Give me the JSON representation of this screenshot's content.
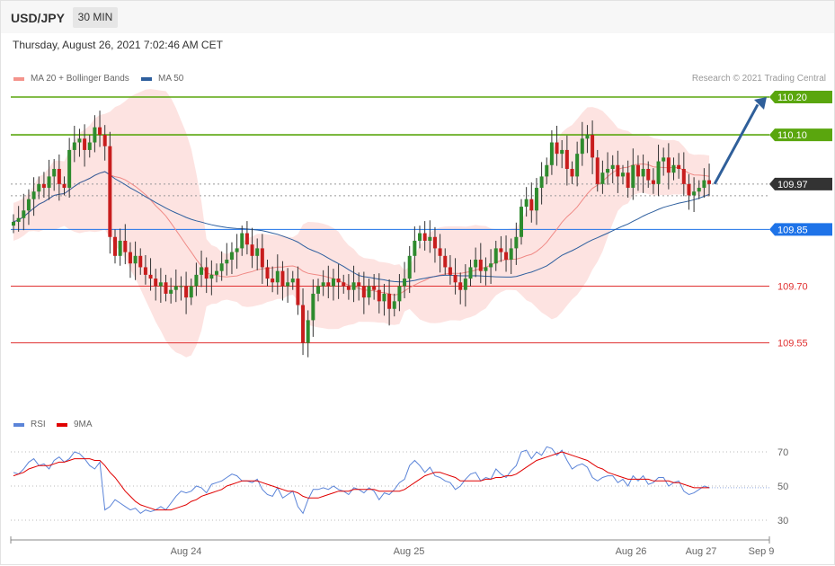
{
  "header": {
    "symbol": "USD/JPY",
    "timeframe": "30 MIN",
    "datetime": "Thursday, August 26, 2021 7:02:46 AM CET"
  },
  "legend": {
    "ma20": {
      "label": "MA 20 + Bollinger Bands",
      "color": "#f08080"
    },
    "ma50": {
      "label": "MA 50",
      "color": "#2e5f9e"
    },
    "copyright": "Research © 2021 Trading Central"
  },
  "rsi_legend": {
    "rsi": {
      "label": "RSI",
      "color": "#5b84d8"
    },
    "ma9": {
      "label": "9MA",
      "color": "#e00000"
    }
  },
  "chart_data": [
    {
      "type": "candlestick",
      "title": "USD/JPY",
      "ylim": [
        109.4,
        110.26
      ],
      "x_ticks": [
        "Aug 24",
        "Aug 25",
        "Aug 26",
        "Aug 27",
        "Sep 9"
      ],
      "levels": [
        {
          "value": 110.2,
          "label": "110.20",
          "color": "#5aa60e",
          "style": "resistance"
        },
        {
          "value": 110.1,
          "label": "110.10",
          "color": "#5aa60e",
          "style": "resistance"
        },
        {
          "value": 109.97,
          "label": "109.97",
          "color": "#333333",
          "style": "last"
        },
        {
          "value": 109.85,
          "label": "109.85",
          "color": "#1e73e8",
          "style": "pivot"
        },
        {
          "value": 109.7,
          "label": "109.70",
          "color": "#e03030",
          "style": "support"
        },
        {
          "value": 109.55,
          "label": "109.55",
          "color": "#e03030",
          "style": "support"
        }
      ],
      "close_series": [
        109.87,
        109.88,
        109.9,
        109.93,
        109.95,
        109.97,
        109.96,
        109.99,
        110.01,
        109.97,
        109.96,
        110.06,
        110.08,
        110.09,
        110.06,
        110.08,
        110.12,
        110.1,
        110.07,
        109.83,
        109.78,
        109.82,
        109.79,
        109.76,
        109.78,
        109.75,
        109.73,
        109.72,
        109.7,
        109.71,
        109.68,
        109.69,
        109.7,
        109.7,
        109.67,
        109.7,
        109.73,
        109.75,
        109.72,
        109.73,
        109.74,
        109.76,
        109.77,
        109.79,
        109.8,
        109.84,
        109.81,
        109.78,
        109.8,
        109.75,
        109.72,
        109.71,
        109.74,
        109.7,
        109.71,
        109.72,
        109.65,
        109.55,
        109.61,
        109.68,
        109.7,
        109.71,
        109.7,
        109.72,
        109.71,
        109.7,
        109.69,
        109.71,
        109.7,
        109.67,
        109.7,
        109.69,
        109.66,
        109.68,
        109.64,
        109.66,
        109.7,
        109.72,
        109.78,
        109.82,
        109.84,
        109.82,
        109.83,
        109.8,
        109.78,
        109.75,
        109.73,
        109.71,
        109.69,
        109.72,
        109.75,
        109.77,
        109.74,
        109.75,
        109.76,
        109.8,
        109.79,
        109.77,
        109.8,
        109.83,
        109.91,
        109.93,
        109.9,
        109.96,
        109.99,
        110.02,
        110.08,
        110.05,
        110.06,
        110.01,
        109.99,
        110.05,
        110.09,
        110.1,
        110.04,
        109.97,
        110.0,
        110.01,
        110.02,
        109.99,
        110.0,
        109.96,
        110.02,
        109.99,
        110.01,
        109.98,
        109.97,
        110.03,
        110.04,
        110.0,
        110.02,
        110.01,
        109.97,
        109.94,
        109.95,
        109.96,
        109.98,
        109.97
      ],
      "high_series_note": "",
      "series": [
        {
          "name": "MA 20 + Bollinger Bands",
          "type": "line+band"
        },
        {
          "name": "MA 50",
          "type": "line"
        }
      ]
    },
    {
      "type": "line",
      "title": "RSI",
      "ylim": [
        20,
        80
      ],
      "y_ticks": [
        70,
        50,
        30
      ],
      "series": [
        {
          "name": "RSI",
          "values": [
            58,
            57,
            60,
            64,
            66,
            62,
            63,
            60,
            65,
            67,
            64,
            66,
            70,
            69,
            66,
            62,
            60,
            64,
            36,
            38,
            42,
            40,
            38,
            36,
            37,
            34,
            36,
            35,
            36,
            38,
            36,
            40,
            44,
            47,
            46,
            47,
            50,
            49,
            46,
            51,
            52,
            53,
            55,
            57,
            56,
            53,
            53,
            52,
            54,
            48,
            45,
            44,
            49,
            43,
            45,
            47,
            38,
            34,
            42,
            48,
            48,
            49,
            48,
            50,
            48,
            47,
            45,
            49,
            48,
            46,
            49,
            47,
            42,
            46,
            45,
            48,
            52,
            54,
            62,
            65,
            62,
            58,
            61,
            56,
            55,
            53,
            52,
            48,
            50,
            54,
            57,
            58,
            53,
            55,
            54,
            60,
            57,
            55,
            59,
            62,
            70,
            71,
            66,
            70,
            68,
            73,
            72,
            68,
            71,
            65,
            60,
            62,
            63,
            61,
            55,
            53,
            55,
            56,
            56,
            52,
            54,
            50,
            56,
            53,
            56,
            51,
            52,
            55,
            55,
            50,
            52,
            53,
            47,
            45,
            46,
            48,
            50,
            49
          ]
        },
        {
          "name": "9MA",
          "values": [
            56,
            57,
            58,
            60,
            61,
            62,
            62,
            62,
            63,
            64,
            64,
            65,
            66,
            66,
            66,
            66,
            65,
            65,
            62,
            58,
            55,
            51,
            47,
            44,
            41,
            39,
            38,
            37,
            36,
            36,
            36,
            36,
            37,
            38,
            39,
            41,
            42,
            44,
            45,
            46,
            47,
            48,
            50,
            51,
            52,
            53,
            53,
            53,
            53,
            52,
            51,
            50,
            49,
            48,
            47,
            47,
            46,
            44,
            43,
            43,
            43,
            44,
            45,
            46,
            47,
            47,
            47,
            48,
            48,
            48,
            48,
            48,
            47,
            47,
            47,
            47,
            47,
            48,
            50,
            52,
            54,
            56,
            57,
            58,
            58,
            57,
            56,
            55,
            53,
            53,
            53,
            53,
            53,
            54,
            54,
            55,
            55,
            56,
            56,
            57,
            59,
            61,
            63,
            65,
            66,
            67,
            68,
            69,
            70,
            69,
            68,
            67,
            66,
            65,
            63,
            61,
            60,
            58,
            57,
            56,
            55,
            54,
            54,
            54,
            54,
            54,
            53,
            53,
            53,
            53,
            52,
            52,
            51,
            50,
            49,
            49,
            49,
            49
          ]
        }
      ]
    }
  ]
}
